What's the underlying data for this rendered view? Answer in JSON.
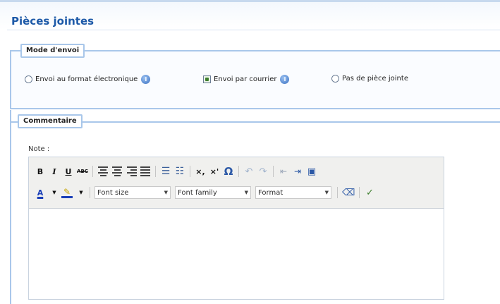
{
  "page": {
    "title": "Pièces jointes"
  },
  "mode_envoi": {
    "legend": "Mode d'envoi",
    "options": [
      {
        "label": "Envoi au format électronique",
        "selected": false,
        "info": true
      },
      {
        "label": "Envoi par courrier",
        "selected": true,
        "info": true
      },
      {
        "label": "Pas de pièce jointe",
        "selected": false,
        "info": false
      }
    ],
    "info_glyph": "i"
  },
  "commentaire": {
    "legend": "Commentaire",
    "note_label": "Note :",
    "toolbar": {
      "row1": [
        "bold",
        "italic",
        "underline",
        "strikethrough",
        "align-left",
        "align-center",
        "align-right",
        "align-justify",
        "bullet-list",
        "numbered-list",
        "subscript",
        "superscript",
        "special-char",
        "undo",
        "redo",
        "outdent",
        "indent",
        "paste-word"
      ],
      "bold": "B",
      "italic": "I",
      "underline": "U",
      "strike": "ABC",
      "subscript": "×,",
      "superscript": "×'",
      "omega": "Ω",
      "font_color": "A",
      "font_size": "Font size",
      "font_family": "Font family",
      "format": "Format"
    }
  },
  "colors": {
    "title": "#1e5aa8",
    "border": "#a9c7ea",
    "toolbar_bg": "#f0f0ee",
    "info_icon": "#3a6fc0"
  }
}
